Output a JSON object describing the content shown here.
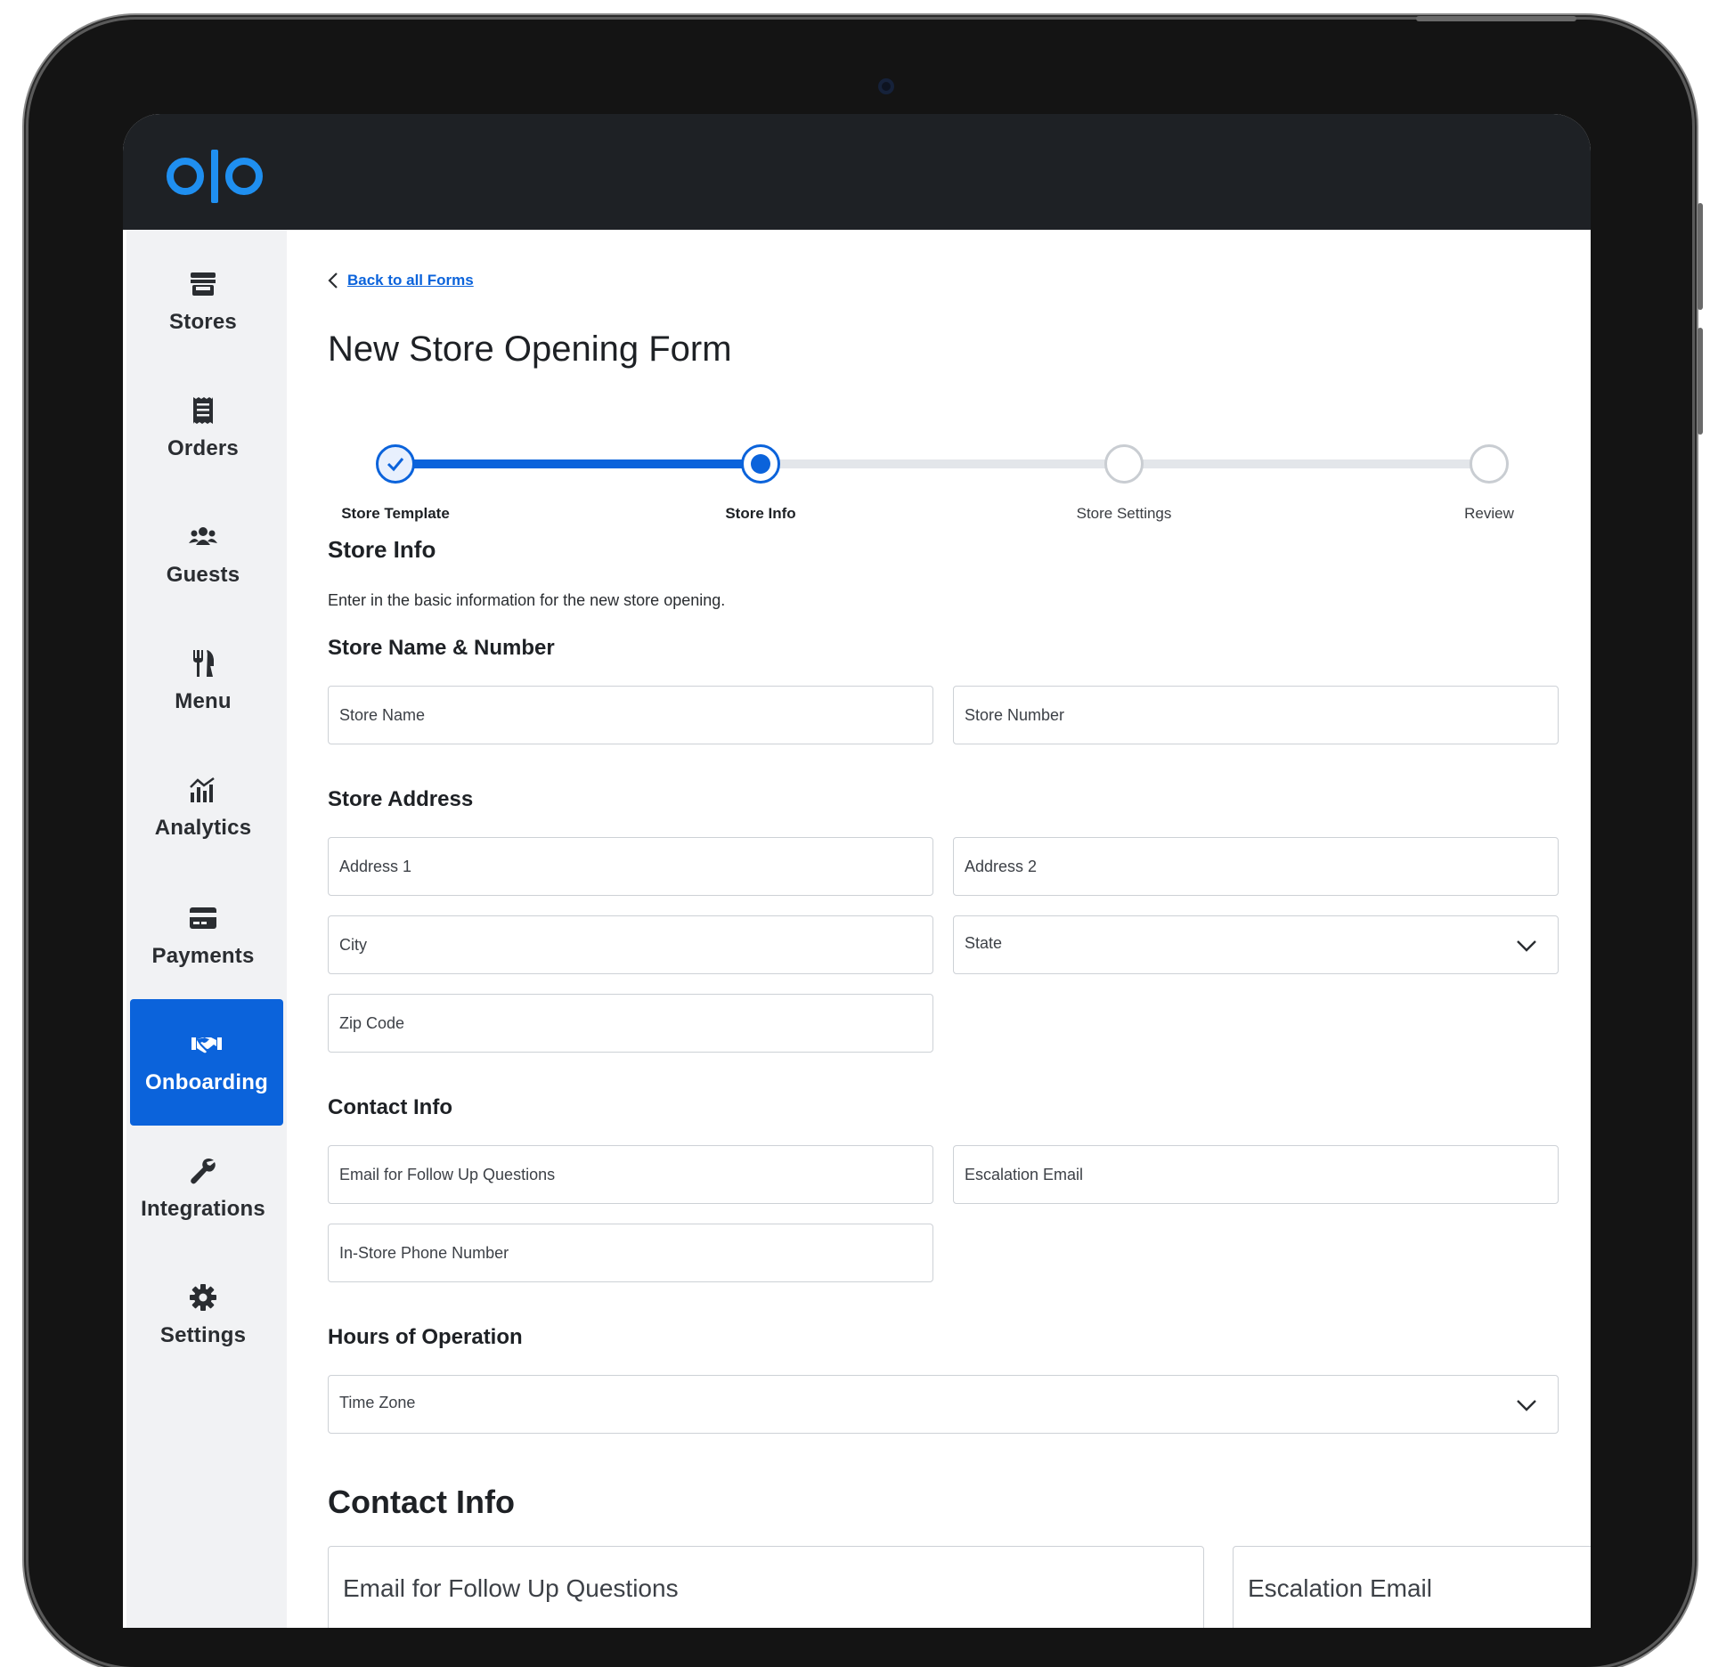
{
  "app": {
    "logo_text": "olo",
    "brand_color": "#1f8ff0",
    "accent_color": "#0b63db"
  },
  "sidebar": {
    "items": [
      {
        "label": "Stores",
        "icon": "store-icon",
        "active": false
      },
      {
        "label": "Orders",
        "icon": "receipt-icon",
        "active": false
      },
      {
        "label": "Guests",
        "icon": "users-icon",
        "active": false
      },
      {
        "label": "Menu",
        "icon": "utensils-icon",
        "active": false
      },
      {
        "label": "Analytics",
        "icon": "analytics-icon",
        "active": false
      },
      {
        "label": "Payments",
        "icon": "credit-card-icon",
        "active": false
      },
      {
        "label": "Onboarding",
        "icon": "handshake-icon",
        "active": true
      },
      {
        "label": "Integrations",
        "icon": "wrench-icon",
        "active": false
      },
      {
        "label": "Settings",
        "icon": "gear-icon",
        "active": false
      }
    ]
  },
  "main": {
    "back_link": "Back to all Forms",
    "title": "New Store Opening Form",
    "steps": [
      {
        "label": "Store Template",
        "state": "complete"
      },
      {
        "label": "Store Info",
        "state": "current"
      },
      {
        "label": "Store Settings",
        "state": "upcoming"
      },
      {
        "label": "Review",
        "state": "upcoming"
      }
    ],
    "section_title": "Store Info",
    "section_description": "Enter in the basic information for the new store opening.",
    "name_number": {
      "heading": "Store Name & Number",
      "store_name_placeholder": "Store Name",
      "store_number_placeholder": "Store Number"
    },
    "address": {
      "heading": "Store Address",
      "address1_placeholder": "Address 1",
      "address2_placeholder": "Address 2",
      "city_placeholder": "City",
      "state_label": "State",
      "zip_placeholder": "Zip Code"
    },
    "contact": {
      "heading": "Contact Info",
      "followup_email_placeholder": "Email for Follow Up Questions",
      "escalation_email_placeholder": "Escalation Email",
      "phone_placeholder": "In-Store Phone Number"
    },
    "hours": {
      "heading": "Hours of Operation",
      "timezone_label": "Time Zone"
    },
    "zoomed_contact": {
      "heading": "Contact Info",
      "followup_email_placeholder": "Email for Follow Up Questions",
      "escalation_email_placeholder": "Escalation Email"
    }
  }
}
